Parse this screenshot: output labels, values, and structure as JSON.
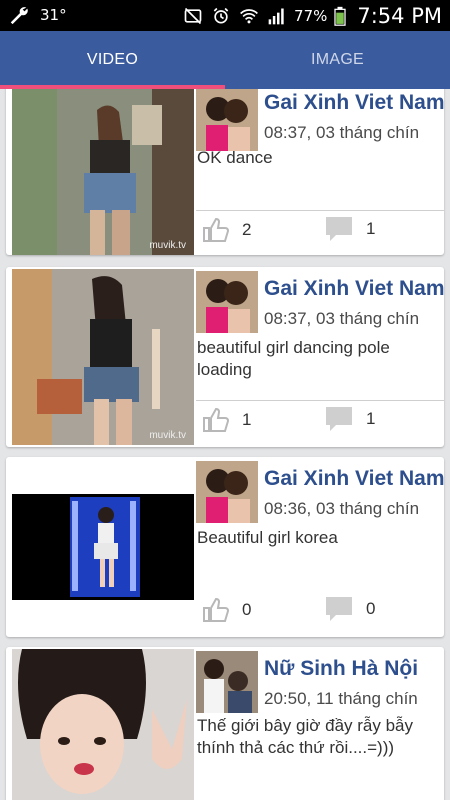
{
  "status_bar": {
    "temperature": "31°",
    "battery_percent": "77%",
    "time": "7:54 PM",
    "icons": [
      "wrench-icon",
      "mute-icon",
      "alarm-icon",
      "wifi-icon",
      "signal-icon",
      "battery-icon"
    ]
  },
  "tabs": [
    {
      "label": "VIDEO",
      "active": true
    },
    {
      "label": "IMAGE",
      "active": false
    }
  ],
  "colors": {
    "header": "#3b5b9f",
    "tab_indicator": "#f04f7b",
    "author": "#2e4f8d"
  },
  "posts": [
    {
      "author": "Gai Xinh Viet Nam",
      "timestamp": "08:37, 03 tháng chín",
      "caption": "OK dance",
      "likes": "2",
      "comments": "1",
      "watermark": "muvik.tv"
    },
    {
      "author": "Gai Xinh Viet Nam",
      "timestamp": "08:37, 03 tháng chín",
      "caption": "beautiful girl dancing pole loading",
      "likes": "1",
      "comments": "1",
      "watermark": "muvik.tv"
    },
    {
      "author": "Gai Xinh Viet Nam",
      "timestamp": "08:36, 03 tháng chín",
      "caption": "Beautiful girl korea",
      "likes": "0",
      "comments": "0"
    },
    {
      "author": "Nữ Sinh Hà Nội",
      "timestamp": "20:50, 11 tháng chín",
      "caption": "Thế giới bây giờ đầy rẫy bẫy thính thả các thứ rồi....=)))"
    }
  ]
}
